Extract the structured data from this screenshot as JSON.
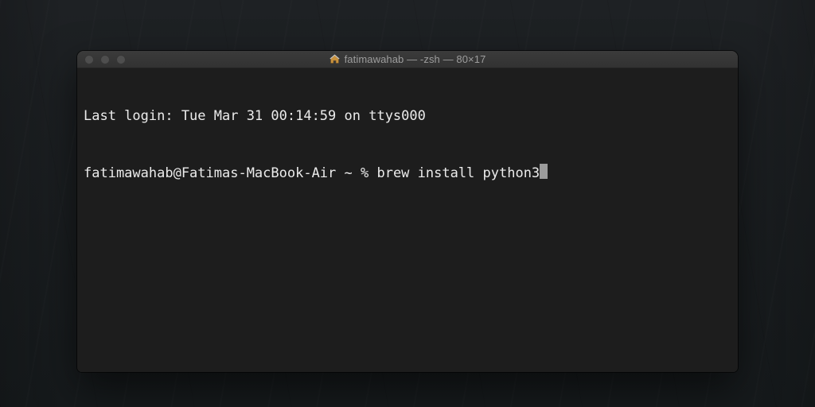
{
  "window": {
    "title": "fatimawahab — -zsh — 80×17"
  },
  "terminal": {
    "last_login": "Last login: Tue Mar 31 00:14:59 on ttys000",
    "prompt": "fatimawahab@Fatimas-MacBook-Air ~ % ",
    "command": "brew install python3"
  }
}
